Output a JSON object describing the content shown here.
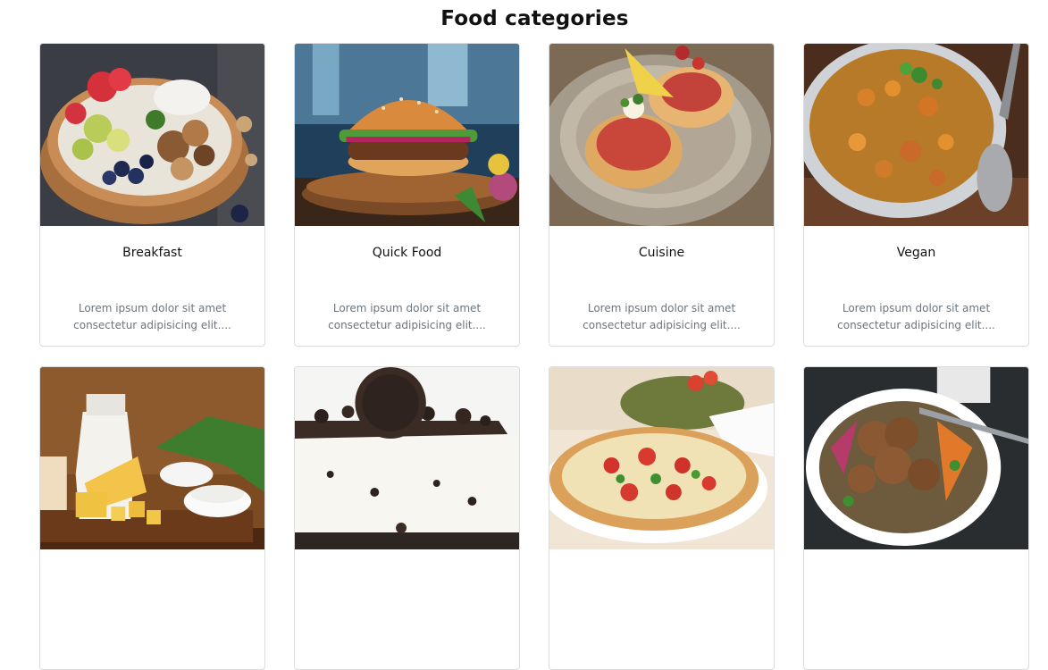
{
  "page": {
    "title": "Food categories"
  },
  "cards": [
    {
      "title": "Breakfast",
      "description": "Lorem ipsum dolor sit amet consectetur adipisicing elit....",
      "image": "fruit-yogurt-bowl"
    },
    {
      "title": "Quick Food",
      "description": "Lorem ipsum dolor sit amet consectetur adipisicing elit....",
      "image": "burger"
    },
    {
      "title": "Cuisine",
      "description": "Lorem ipsum dolor sit amet consectetur adipisicing elit....",
      "image": "stuffed-potatoes"
    },
    {
      "title": "Vegan",
      "description": "Lorem ipsum dolor sit amet consectetur adipisicing elit....",
      "image": "chickpea-curry-pot"
    },
    {
      "title": "",
      "description": "",
      "image": "dairy-milk-cheese"
    },
    {
      "title": "",
      "description": "",
      "image": "oreo-cheesecake"
    },
    {
      "title": "",
      "description": "",
      "image": "margherita-pizza"
    },
    {
      "title": "",
      "description": "",
      "image": "meatball-salad-bowl"
    }
  ]
}
